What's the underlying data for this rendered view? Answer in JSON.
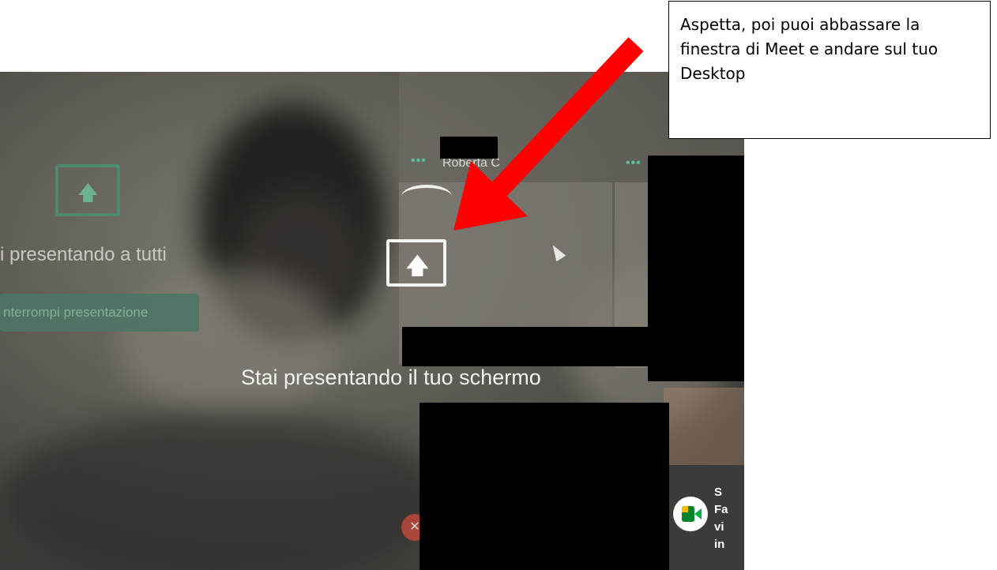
{
  "callout": {
    "text": "Aspetta, poi puoi abbassare la finestra di Meet e andare sul tuo Desktop"
  },
  "meet": {
    "faded_status": "i presentando a tutti",
    "stop_button": "nterrompi presentazione",
    "participant_name": "Roberta C",
    "more_options": "•••",
    "presenting_message": "Stai presentando il tuo schermo",
    "share_icon": "present-screen-icon",
    "toast_lines": [
      "S",
      "Fa",
      "vi",
      "in"
    ]
  },
  "colors": {
    "arrow": "#ff0000",
    "meet_green": "#5fb89a",
    "redaction": "#000000"
  }
}
